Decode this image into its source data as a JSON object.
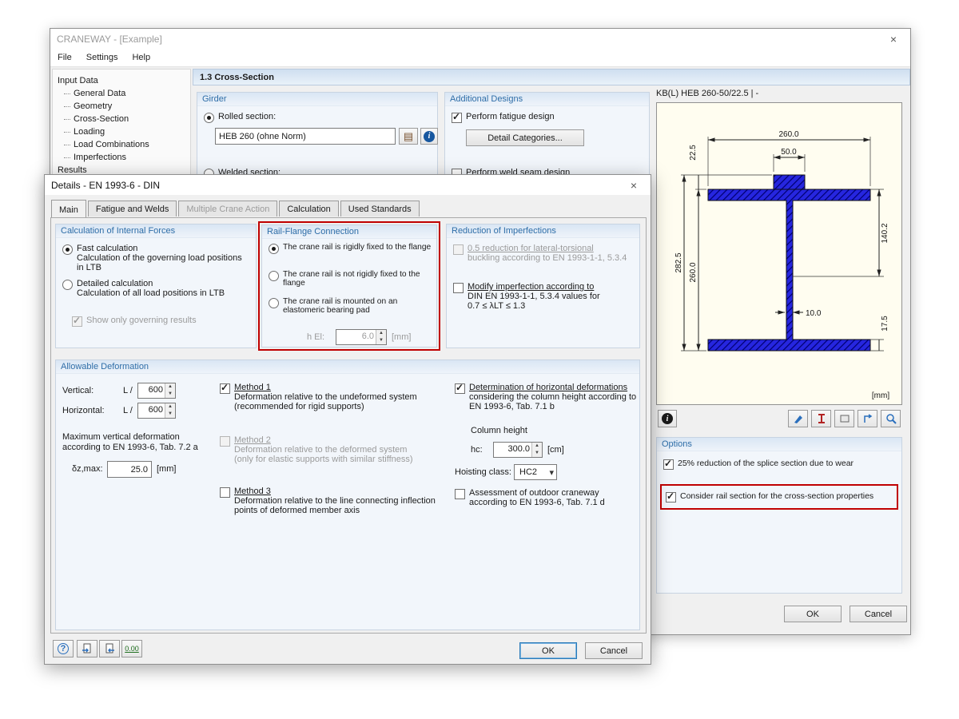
{
  "glyphs": {
    "close": "×",
    "book": "▤",
    "info": "i",
    "help": "?"
  },
  "colors": {
    "highlight_red": "#c00000",
    "section_fill": "#2626df",
    "group_header_text": "#2f6ea8"
  },
  "window": {
    "title": "CRANEWAY - [Example]",
    "menu": [
      "File",
      "Settings",
      "Help"
    ],
    "tree": {
      "input_data": "Input Data",
      "items": [
        "General Data",
        "Geometry",
        "Cross-Section",
        "Loading",
        "Load Combinations",
        "Imperfections"
      ],
      "results": "Results"
    },
    "header": "1.3 Cross-Section",
    "girder": {
      "title": "Girder",
      "rolled": "Rolled section:",
      "section_value": "HEB 260 (ohne Norm)",
      "welded": "Welded section:"
    },
    "additional": {
      "title": "Additional Designs",
      "fatigue": "Perform fatigue design",
      "detail_categories": "Detail Categories...",
      "weld_seam": "Perform weld seam design"
    },
    "options": {
      "title": "Options",
      "wear": "25% reduction of the splice section due to wear",
      "rail_section": "Consider rail section for the cross-section properties"
    },
    "ok": "OK",
    "cancel": "Cancel"
  },
  "drawing": {
    "caption": "KB(L) HEB 260-50/22.5 | -",
    "unit": "[mm]",
    "dims": {
      "flange_width": "260.0",
      "rail_width": "50.0",
      "rail_height": "22.5",
      "upper_part": "140.2",
      "total_height": "282.5",
      "beam_height": "260.0",
      "web_thickness": "10.0",
      "flange_thickness": "17.5"
    }
  },
  "dialog": {
    "title": "Details - EN 1993-6 - DIN",
    "tabs": [
      "Main",
      "Fatigue and Welds",
      "Multiple Crane Action",
      "Calculation",
      "Used Standards"
    ],
    "internal_forces": {
      "title": "Calculation of Internal Forces",
      "fast": "Fast calculation",
      "fast_desc_l1": "Calculation of the governing load positions",
      "fast_desc_l2": "in LTB",
      "detailed": "Detailed calculation",
      "detailed_desc": "Calculation of all load positions in LTB",
      "show_governing": "Show only governing results"
    },
    "rail_flange": {
      "title": "Rail-Flange Connection",
      "opt1": "The crane rail is rigidly fixed to the flange",
      "opt2": "The crane rail is not rigidly fixed to the flange",
      "opt3": "The crane rail is mounted on an elastomeric bearing pad",
      "hel_label": "h El:",
      "hel_value": "6.0",
      "hel_unit": "[mm]"
    },
    "imperfections": {
      "title": "Reduction of Imperfections",
      "reduction05_l1": "0.5 reduction for lateral-torsional",
      "reduction05_l2": "buckling according to EN 1993-1-1, 5.3.4",
      "modify_l1": "Modify imperfection according to",
      "modify_l2": "DIN EN 1993-1-1, 5.3.4 values for",
      "modify_l3": "0.7 ≤ λLT ≤ 1.3"
    },
    "deformation": {
      "title": "Allowable Deformation",
      "vertical": "Vertical:",
      "horizontal": "Horizontal:",
      "l_over": "L /",
      "vertical_value": "600",
      "horizontal_value": "600",
      "max_l1": "Maximum vertical deformation",
      "max_l2": "according to EN 1993-6, Tab. 7.2 a",
      "delta_label": "δz,max:",
      "delta_value": "25.0",
      "delta_unit": "[mm]",
      "method1": "Method 1",
      "method1_desc_l1": "Deformation relative to the undeformed system",
      "method1_desc_l2": "(recommended for rigid supports)",
      "method2": "Method 2",
      "method2_desc_l1": "Deformation relative to the deformed system",
      "method2_desc_l2": "(only for elastic supports with similar stiffness)",
      "method3": "Method 3",
      "method3_desc_l1": "Deformation relative to the line connecting inflection",
      "method3_desc_l2": "points of deformed member axis",
      "det_l1": "Determination of horizontal deformations",
      "det_l2": "considering the column height according to",
      "det_l3": "EN 1993-6, Tab. 7.1 b",
      "column_height": "Column height",
      "hc_label": "hc:",
      "hc_value": "300.0",
      "hc_unit": "[cm]",
      "hoisting_label": "Hoisting class:",
      "hoisting_value": "HC2",
      "outdoor_l1": "Assessment of outdoor craneway",
      "outdoor_l2": "according to EN 1993-6, Tab. 7.1 d"
    },
    "footer": {
      "number_format": "0.00",
      "ok": "OK",
      "cancel": "Cancel"
    }
  }
}
